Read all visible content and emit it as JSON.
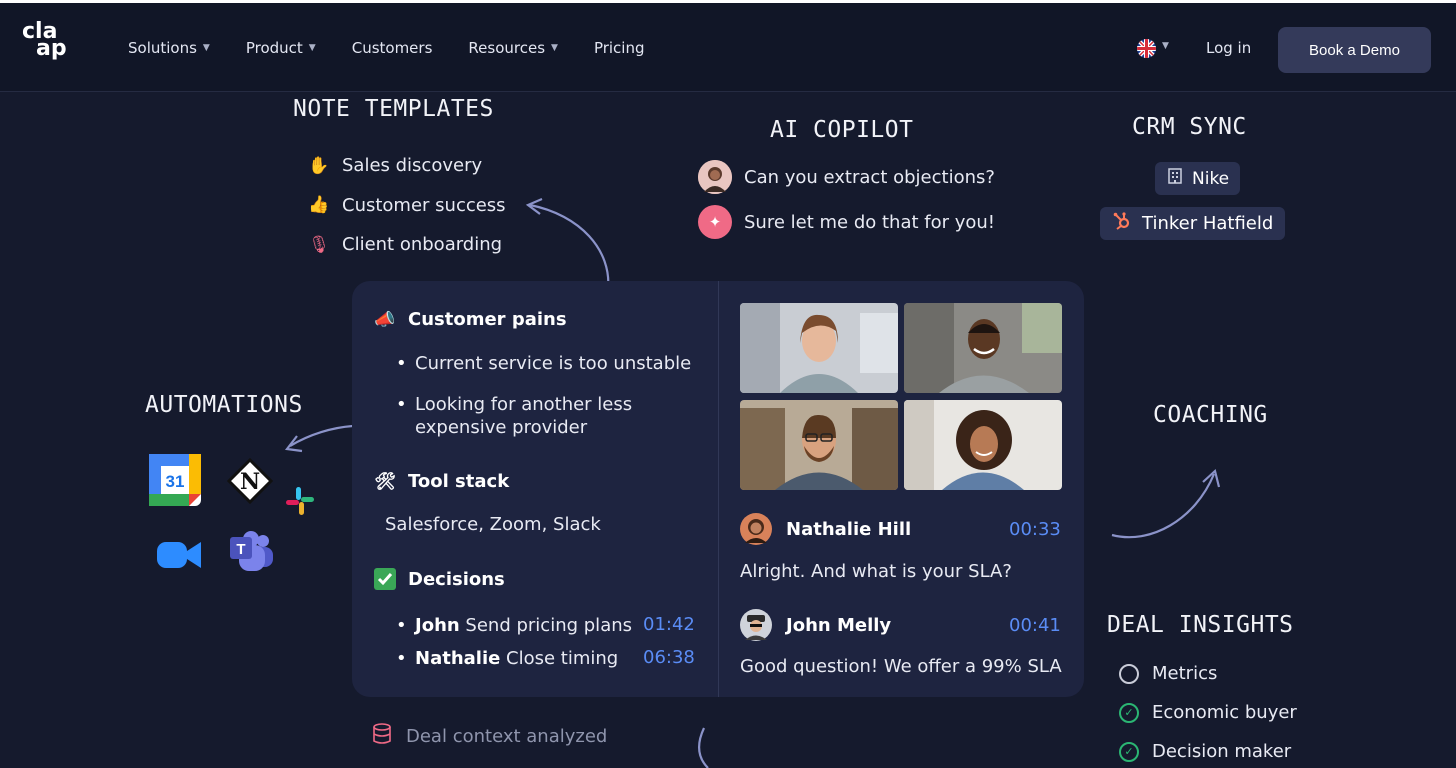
{
  "nav": {
    "logo": [
      "cla",
      "ap"
    ],
    "items": [
      {
        "label": "Solutions",
        "dropdown": true
      },
      {
        "label": "Product",
        "dropdown": true
      },
      {
        "label": "Customers",
        "dropdown": false
      },
      {
        "label": "Resources",
        "dropdown": true
      },
      {
        "label": "Pricing",
        "dropdown": false
      }
    ],
    "language_icon": "uk-flag-icon",
    "login": "Log in",
    "cta": "Book a Demo"
  },
  "note_templates": {
    "title": "NOTE TEMPLATES",
    "items": [
      {
        "label": "Sales discovery",
        "icon": "wave-hand-icon"
      },
      {
        "label": "Customer success",
        "icon": "thumbs-up-icon"
      },
      {
        "label": "Client onboarding",
        "icon": "microphone-icon"
      }
    ]
  },
  "ai_copilot": {
    "title": "AI COPILOT",
    "question": "Can you extract objections?",
    "answer": "Sure let me do that for you!"
  },
  "crm_sync": {
    "title": "CRM SYNC",
    "company": "Nike",
    "contact": "Tinker Hatfield"
  },
  "automations": {
    "title": "AUTOMATIONS",
    "apps": [
      "google-calendar-icon",
      "notion-icon",
      "slack-icon",
      "zoom-icon",
      "teams-icon"
    ]
  },
  "coaching": {
    "title": "COACHING"
  },
  "notes": {
    "customer_pains": {
      "title": "Customer pains",
      "bullets": [
        "Current service is too unstable",
        "Looking for another less",
        "expensive provider"
      ]
    },
    "tool_stack": {
      "title": "Tool stack",
      "text": "Salesforce, Zoom, Slack"
    },
    "decisions": {
      "title": "Decisions",
      "items": [
        {
          "name": "John",
          "text": " Send pricing plans",
          "time": "01:42"
        },
        {
          "name": "Nathalie",
          "text": " Close timing",
          "time": "06:38"
        }
      ]
    }
  },
  "transcript": [
    {
      "speaker": "Nathalie Hill",
      "time": "00:33",
      "text": "Alright. And what is your SLA?"
    },
    {
      "speaker": "John Melly",
      "time": "00:41",
      "text": "Good question! We offer a 99% SLA"
    }
  ],
  "deal_insights": {
    "title": "DEAL INSIGHTS",
    "items": [
      {
        "label": "Metrics",
        "checked": false
      },
      {
        "label": "Economic buyer",
        "checked": true
      },
      {
        "label": "Decision maker",
        "checked": true
      }
    ]
  },
  "bottom": {
    "status": "Deal context analyzed"
  },
  "colors": {
    "background": "#151a2d",
    "nav": "#111627",
    "card": "#1e2440",
    "accent_pink": "#f06a86",
    "timestamp_blue": "#5a8cf5",
    "check_green": "#2bb673"
  }
}
